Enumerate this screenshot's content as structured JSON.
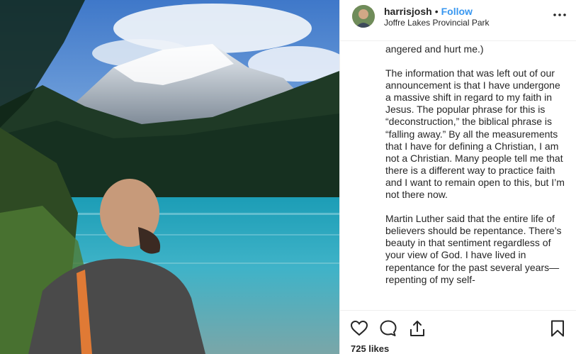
{
  "post": {
    "username": "harrisjosh",
    "separator": "•",
    "follow_label": "Follow",
    "location": "Joffre Lakes Provincial Park",
    "caption_paragraphs": [
      "angered and hurt me.)",
      "The information that was left out of our announcement is that I have undergone a massive shift in regard to my faith in Jesus. The popular phrase for this is “deconstruction,” the biblical phrase is “falling away.” By all the measurements that I have for defining a Christian, I am not a Christian. Many people tell me that there is a different way to practice faith and I want to remain open to this, but I’m not there now.",
      "Martin Luther said that the entire life of believers should be repentance. There’s beauty in that sentiment regardless of your view of God. I have lived in repentance for the past several years—repenting of my self-"
    ],
    "likes_text": "725 likes",
    "icons": {
      "more": "more-options-icon",
      "like": "heart-icon",
      "comment": "comment-icon",
      "share": "share-icon",
      "save": "bookmark-icon"
    },
    "colors": {
      "link": "#3897f0",
      "text": "#262626",
      "lake": "#3fb3c8"
    }
  }
}
